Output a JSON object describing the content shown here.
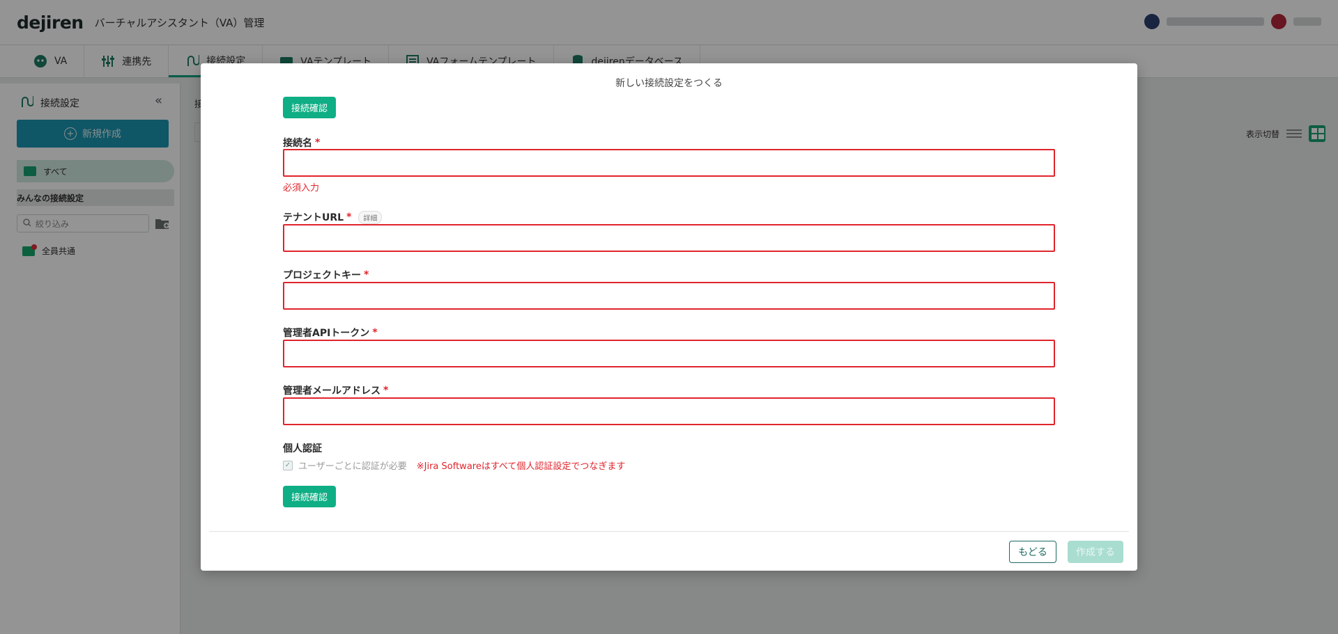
{
  "header": {
    "logo": "dejiren",
    "title": "バーチャルアシスタント（VA）管理"
  },
  "tabs": [
    {
      "label": "VA",
      "icon": "robot-icon"
    },
    {
      "label": "連携先",
      "icon": "sliders-icon"
    },
    {
      "label": "接続設定",
      "icon": "connection-icon"
    },
    {
      "label": "VAテンプレート",
      "icon": "template-icon"
    },
    {
      "label": "VAフォームテンプレート",
      "icon": "form-template-icon"
    },
    {
      "label": "dejirenデータベース",
      "icon": "database-icon"
    }
  ],
  "sidebar": {
    "title": "接続設定",
    "new_button": "新規作成",
    "all_label": "すべて",
    "shared_heading": "みんなの接続設定",
    "filter_placeholder": "絞り込み",
    "items": [
      {
        "label": "全員共通"
      }
    ]
  },
  "main": {
    "tab_initial": "接",
    "view_switch_label": "表示切替"
  },
  "modal": {
    "title": "新しい接続設定をつくる",
    "check_button": "接続確認",
    "fields": [
      {
        "label": "接続名",
        "required": "*",
        "value": "",
        "error": "必須入力"
      },
      {
        "label": "テナントURL",
        "required": "*",
        "detail": "詳細",
        "value": ""
      },
      {
        "label": "プロジェクトキー",
        "required": "*",
        "value": ""
      },
      {
        "label": "管理者APIトークン",
        "required": "*",
        "value": ""
      },
      {
        "label": "管理者メールアドレス",
        "required": "*",
        "value": ""
      }
    ],
    "personal_auth": {
      "label": "個人認証",
      "checkbox_label": "ユーザーごとに認証が必要",
      "note": "※Jira Softwareはすべて個人認証設定でつなぎます",
      "checked": true
    },
    "back_button": "もどる",
    "create_button": "作成する"
  },
  "colors": {
    "accent": "#0fae84",
    "error": "#e0242b",
    "primary_blue": "#1b94b0"
  }
}
